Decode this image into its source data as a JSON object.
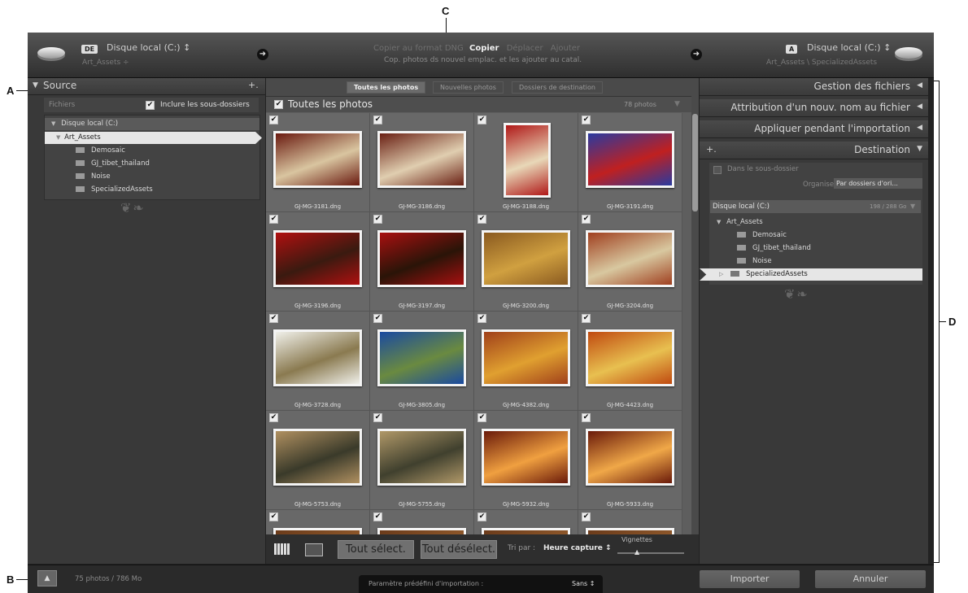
{
  "annotations": {
    "a": "A",
    "b": "B",
    "c": "C",
    "d": "D"
  },
  "header": {
    "source_disk": "Disque local (C:) ↕",
    "source_badge": "DE",
    "source_path": "Art_Assets ÷",
    "modes": {
      "copy_dng": "Copier au format DNG",
      "copy": "Copier",
      "move": "Déplacer",
      "add": "Ajouter"
    },
    "mode_description": "Cop. photos ds nouvel emplac. et les ajouter au catal.",
    "dest_badge": "A",
    "dest_disk": "Disque local (C:) ↕",
    "dest_path": "Art_Assets \\ SpecializedAssets"
  },
  "left_panel": {
    "title": "Source",
    "add": "+.",
    "files_label": "Fichiers",
    "include_subfolders": "Inclure les sous-dossiers",
    "drive": "Disque local (C:)",
    "root_folder": "Art_Assets",
    "folders": [
      "Demosaic",
      "GJ_tibet_thailand",
      "Noise",
      "SpecializedAssets"
    ]
  },
  "center": {
    "tabs": [
      "Toutes les photos",
      "Nouvelles photos",
      "Dossiers de destination"
    ],
    "grid_title": "Toutes les photos",
    "photo_count": "78 photos",
    "photos": [
      {
        "name": "GJ-MG-3181.dng",
        "c1": "#6a1a10",
        "c2": "#d9c5a0"
      },
      {
        "name": "GJ-MG-3186.dng",
        "c1": "#6a2014",
        "c2": "#e0ceb0"
      },
      {
        "name": "GJ-MG-3188.dng",
        "c1": "#b01818",
        "c2": "#e8d8b8"
      },
      {
        "name": "GJ-MG-3191.dng",
        "c1": "#2a3aa0",
        "c2": "#c02020"
      },
      {
        "name": "GJ-MG-3196.dng",
        "c1": "#b01010",
        "c2": "#3a1a10"
      },
      {
        "name": "GJ-MG-3197.dng",
        "c1": "#a81010",
        "c2": "#2a1408"
      },
      {
        "name": "GJ-MG-3200.dng",
        "c1": "#8a5a20",
        "c2": "#d0a040"
      },
      {
        "name": "GJ-MG-3204.dng",
        "c1": "#a04020",
        "c2": "#d8c8a0"
      },
      {
        "name": "GJ-MG-3728.dng",
        "c1": "#f0f0ea",
        "c2": "#8a7a50"
      },
      {
        "name": "GJ-MG-3805.dng",
        "c1": "#1a4aa0",
        "c2": "#6a8a40"
      },
      {
        "name": "GJ-MG-4382.dng",
        "c1": "#a0401a",
        "c2": "#e0a030"
      },
      {
        "name": "GJ-MG-4423.dng",
        "c1": "#c04a10",
        "c2": "#e8c050"
      },
      {
        "name": "GJ-MG-5753.dng",
        "c1": "#b09060",
        "c2": "#3a3a2a"
      },
      {
        "name": "GJ-MG-5755.dng",
        "c1": "#b09868",
        "c2": "#40402e"
      },
      {
        "name": "GJ-MG-5932.dng",
        "c1": "#6a1a0a",
        "c2": "#f0a040"
      },
      {
        "name": "GJ-MG-5933.dng",
        "c1": "#6a1a0a",
        "c2": "#f0a848"
      }
    ],
    "select_all": "Tout sélect.",
    "deselect_all": "Tout désélect.",
    "sort_label": "Tri par :",
    "sort_value": "Heure capture ↕",
    "thumbnails_label": "Vignettes"
  },
  "right_panel": {
    "file_handling": "Gestion des fichiers",
    "rename": "Attribution d'un nouv. nom au fichier",
    "apply": "Appliquer pendant l'importation",
    "destination": "Destination",
    "add": "+.",
    "subfolder": "Dans le sous-dossier",
    "organize_label": "Organiser",
    "organize_value": "Par dossiers d'ori...",
    "drive": "Disque local (C:)",
    "drive_space": "198 / 288 Go",
    "root_folder": "Art_Assets",
    "folders": [
      "Demosaic",
      "GJ_tibet_thailand",
      "Noise",
      "SpecializedAssets"
    ]
  },
  "bottom": {
    "status": "75 photos / 786 Mo",
    "preset_label": "Paramètre prédéfini d'importation :",
    "preset_value": "Sans ↕",
    "import": "Importer",
    "cancel": "Annuler"
  }
}
